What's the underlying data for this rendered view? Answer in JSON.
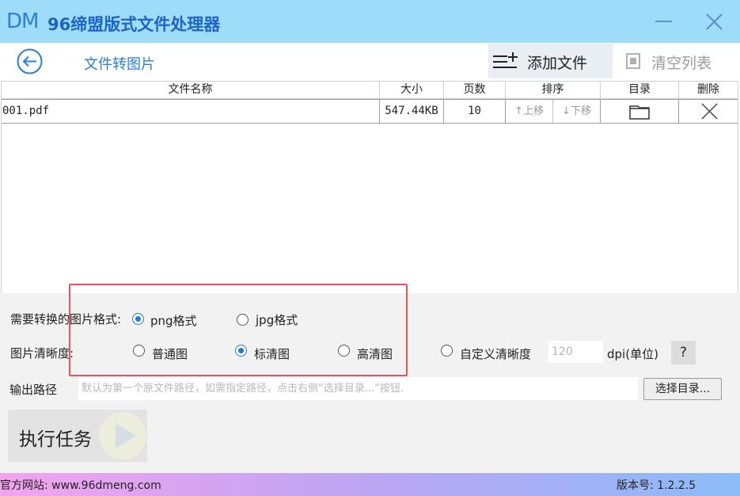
{
  "window": {
    "logo": "DM",
    "title": "96缔盟版式文件处理器"
  },
  "toolbar": {
    "page_title": "文件转图片",
    "add_file_label": "添加文件",
    "clear_list_label": "清空列表"
  },
  "table": {
    "headers": {
      "name": "文件名称",
      "size": "大小",
      "pages": "页数",
      "sort": "排序",
      "dir": "目录",
      "delete": "删除"
    },
    "rows": [
      {
        "name": "001.pdf",
        "size": "547.44KB",
        "pages": "10",
        "move_up": "上移",
        "move_down": "下移"
      }
    ]
  },
  "options": {
    "format_label": "需要转换的图片格式:",
    "format_png": "png格式",
    "format_jpg": "jpg格式",
    "selected_format": "png格式",
    "clarity_label": "图片清晰度:",
    "clarity_normal": "普通图",
    "clarity_standard": "标清图",
    "clarity_high": "高清图",
    "clarity_custom": "自定义清晰度",
    "selected_clarity": "标清图",
    "dpi_placeholder": "120",
    "dpi_unit": "dpi(单位)",
    "help": "?",
    "output_label": "输出路径",
    "output_placeholder": "默认为第一个原文件路径，如需指定路径，点击右侧“选择目录...”按钮.",
    "browse_label": "选择目录...",
    "run_label": "执行任务"
  },
  "status": {
    "website": "官方网站:  www.96dmeng.com",
    "version": "版本号: 1.2.2.5"
  },
  "colors": {
    "accent": "#1f7ad8",
    "titlebar": "#9fdcf9",
    "highlight": "#e8545b"
  }
}
